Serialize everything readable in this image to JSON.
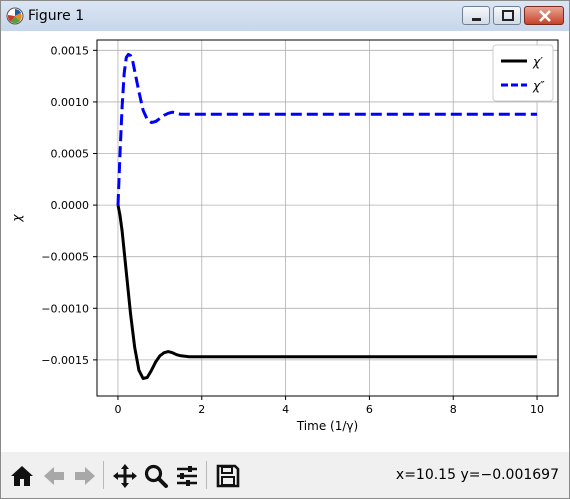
{
  "window": {
    "title": "Figure 1"
  },
  "toolbar": {
    "buttons": [
      "home-icon",
      "back-arrow-icon",
      "forward-arrow-icon",
      "pan-icon",
      "zoom-icon",
      "configure-subplots-icon",
      "save-icon"
    ],
    "coordinates": "x=10.15 y=−0.001697"
  },
  "chart_data": {
    "type": "line",
    "title": "",
    "xlabel": "Time (1/γ)",
    "ylabel": "χ",
    "xlim": [
      -0.5,
      10.5
    ],
    "ylim": [
      -0.00185,
      0.0016
    ],
    "x_ticks": [
      0,
      2,
      4,
      6,
      8,
      10
    ],
    "x_tick_labels": [
      "0",
      "2",
      "4",
      "6",
      "8",
      "10"
    ],
    "y_ticks": [
      0.0015,
      0.001,
      0.0005,
      0.0,
      -0.0005,
      -0.001,
      -0.0015
    ],
    "y_tick_labels": [
      "0.0015",
      "0.0010",
      "0.0005",
      "0.0000",
      "−0.0005",
      "−0.0010",
      "−0.0015"
    ],
    "grid": true,
    "legend_position": "top-right",
    "series": [
      {
        "name": "χ′",
        "color": "#000000",
        "style": "solid",
        "x": [
          0,
          0.05,
          0.1,
          0.2,
          0.3,
          0.4,
          0.5,
          0.6,
          0.7,
          0.8,
          0.9,
          1.0,
          1.1,
          1.2,
          1.3,
          1.4,
          1.5,
          1.7,
          2.0,
          2.5,
          3,
          4,
          5,
          6,
          7,
          8,
          9,
          10
        ],
        "y": [
          0,
          -0.0001,
          -0.00025,
          -0.00065,
          -0.00105,
          -0.00138,
          -0.0016,
          -0.00168,
          -0.00167,
          -0.0016,
          -0.00152,
          -0.00146,
          -0.00143,
          -0.00142,
          -0.00143,
          -0.00145,
          -0.00146,
          -0.00147,
          -0.00147,
          -0.00147,
          -0.00147,
          -0.00147,
          -0.00147,
          -0.00147,
          -0.00147,
          -0.00147,
          -0.00147,
          -0.00147
        ]
      },
      {
        "name": "χ″",
        "color": "#0000ff",
        "style": "dashed",
        "x": [
          0,
          0.05,
          0.1,
          0.15,
          0.2,
          0.25,
          0.3,
          0.35,
          0.4,
          0.5,
          0.6,
          0.7,
          0.8,
          0.9,
          1.0,
          1.1,
          1.2,
          1.3,
          1.4,
          1.5,
          1.7,
          2.0,
          2.5,
          3,
          4,
          5,
          6,
          7,
          8,
          9,
          10
        ],
        "y": [
          0,
          0.0005,
          0.00095,
          0.00128,
          0.00143,
          0.00146,
          0.00145,
          0.0014,
          0.0013,
          0.0011,
          0.00092,
          0.00083,
          0.0008,
          0.00081,
          0.00084,
          0.00087,
          0.00089,
          0.0009,
          0.00089,
          0.00088,
          0.00088,
          0.00088,
          0.00088,
          0.00088,
          0.00088,
          0.00088,
          0.00088,
          0.00088,
          0.00088,
          0.00088,
          0.00088
        ]
      }
    ]
  }
}
